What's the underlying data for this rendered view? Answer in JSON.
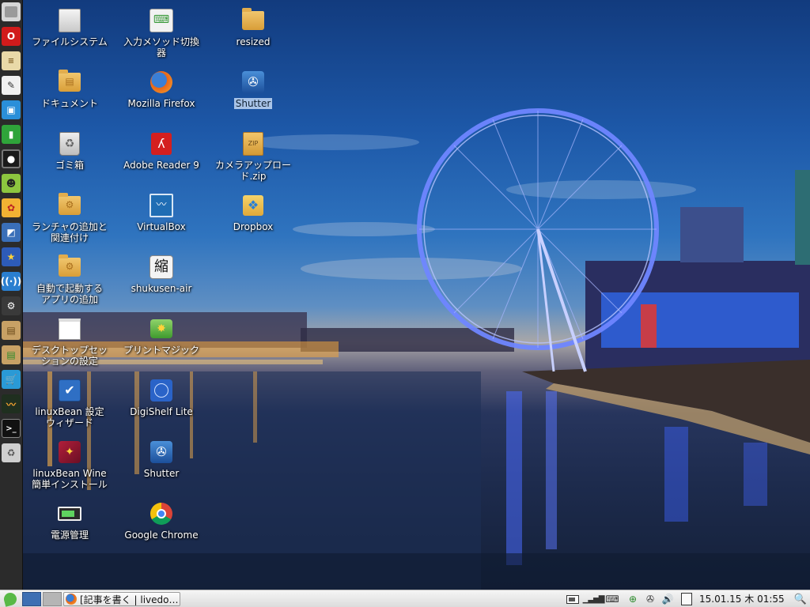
{
  "desktop": {
    "icons": [
      {
        "label": "ファイルシステム",
        "icon": "hard-drive-icon"
      },
      {
        "label": "ドキュメント",
        "icon": "documents-folder-icon"
      },
      {
        "label": "ゴミ箱",
        "icon": "trash-icon"
      },
      {
        "label": "ランチャの追加と関連付け",
        "icon": "folder-gear-icon"
      },
      {
        "label": "自動で起動するアプリの追加",
        "icon": "folder-gear-icon"
      },
      {
        "label": "デスクトップセッションの設定",
        "icon": "blank-document-icon"
      },
      {
        "label": "linuxBean 設定ウィザード",
        "icon": "checkbox-wizard-icon"
      },
      {
        "label": "linuxBean Wine 簡単インストール",
        "icon": "wine-wand-icon"
      },
      {
        "label": "電源管理",
        "icon": "battery-icon"
      },
      {
        "label": "入力メソッド切換器",
        "icon": "keyboard-icon"
      },
      {
        "label": "Mozilla Firefox",
        "icon": "firefox-icon"
      },
      {
        "label": "Adobe Reader 9",
        "icon": "pdf-icon"
      },
      {
        "label": "VirtualBox",
        "icon": "virtualbox-icon"
      },
      {
        "label": "shukusen-air",
        "icon": "kanji-shuku-icon",
        "glyph": "縮"
      },
      {
        "label": "プリントマジック",
        "icon": "printer-icon"
      },
      {
        "label": "DigiShelf Lite",
        "icon": "globe-icon"
      },
      {
        "label": "Shutter",
        "icon": "shutter-icon"
      },
      {
        "label": "Google Chrome",
        "icon": "chrome-icon"
      },
      {
        "label": "resized",
        "icon": "folder-icon"
      },
      {
        "label": "Shutter",
        "icon": "shutter-icon",
        "selected": true
      },
      {
        "label": "カメラアップロード.zip",
        "icon": "zip-archive-icon",
        "glyph": "ZIP"
      },
      {
        "label": "Dropbox",
        "icon": "dropbox-icon"
      }
    ]
  },
  "dock": {
    "items": [
      "file-manager-icon",
      "opera-icon",
      "text-editor-icon",
      "pen-editor-icon",
      "image-viewer-icon",
      "green-notebook-icon",
      "media-player-icon",
      "mascot-icon",
      "paint-icon",
      "image-editor-icon",
      "star-app-icon",
      "network-icon",
      "settings-icon",
      "package-install-icon",
      "package-update-icon",
      "store-icon",
      "system-monitor-icon",
      "terminal-icon",
      "trash-icon"
    ]
  },
  "taskbar": {
    "menu_icon": "linuxbean-menu-icon",
    "window_button": {
      "label": "[記事を書く | livedo…",
      "icon": "firefox-icon"
    },
    "clock": "15.01.15 木 01:55",
    "tray_icons": [
      "battery-tray-icon",
      "signal-bars-icon",
      "keyboard-tray-icon",
      "network-tray-icon",
      "shutter-tray-icon",
      "volume-icon",
      "clipboard-icon"
    ]
  },
  "colors": {
    "selection": "#a9c4e8",
    "dock": "#2b2b2b",
    "taskbar": "#e6e6e6"
  }
}
